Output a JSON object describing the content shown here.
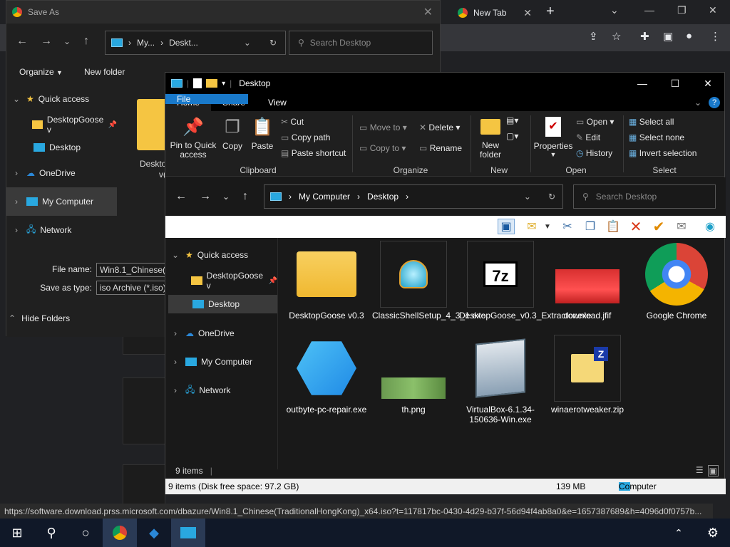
{
  "chrome": {
    "tab_title": "New Tab",
    "tab_close": "✕",
    "new_tab": "+"
  },
  "save_as": {
    "title": "Save As",
    "address": [
      "My...",
      "Deskt..."
    ],
    "search_placeholder": "Search Desktop",
    "organize": "Organize",
    "new_folder": "New folder",
    "tree": [
      {
        "label": "Quick access"
      },
      {
        "label": "DesktopGoose v"
      },
      {
        "label": "Desktop"
      },
      {
        "label": "OneDrive"
      },
      {
        "label": "My Computer"
      },
      {
        "label": "Network"
      }
    ],
    "file_name_label": "File name:",
    "file_name_value": "Win8.1_Chinese(T",
    "save_as_type_label": "Save as type:",
    "save_as_type_value": "iso Archive (*.iso)",
    "hide_folders": "Hide Folders",
    "partial_file_label": "Deskto",
    "partial_file_label2": "v("
  },
  "explorer": {
    "title": "Desktop",
    "tabs": [
      "File",
      "Home",
      "Share",
      "View"
    ],
    "ribbon": {
      "pin": "Pin to Quick access",
      "copy": "Copy",
      "paste": "Paste",
      "cut": "Cut",
      "copy_path": "Copy path",
      "paste_shortcut": "Paste shortcut",
      "clipboard": "Clipboard",
      "move_to": "Move to",
      "copy_to": "Copy to",
      "delete": "Delete",
      "rename": "Rename",
      "organize": "Organize",
      "new_folder": "New folder",
      "new": "New",
      "properties": "Properties",
      "open": "Open",
      "edit": "Edit",
      "history": "History",
      "open_group": "Open",
      "select_all": "Select all",
      "select_none": "Select none",
      "invert_selection": "Invert selection",
      "select_group": "Select"
    },
    "address": [
      "My Computer",
      "Desktop"
    ],
    "search_placeholder": "Search Desktop",
    "tree": [
      {
        "label": "Quick access"
      },
      {
        "label": "DesktopGoose v"
      },
      {
        "label": "Desktop"
      },
      {
        "label": "OneDrive"
      },
      {
        "label": "My Computer"
      },
      {
        "label": "Network"
      }
    ],
    "files": [
      {
        "name": "DesktopGoose v0.3",
        "icon": "folder-icon"
      },
      {
        "name": "ClassicShellSetup_4_3_1.exe",
        "icon": "shell-icon"
      },
      {
        "name": "DesktopGoose_v0.3_Extractor.exe",
        "icon": "7z-icon"
      },
      {
        "name": "download.jfif",
        "icon": "image-icon"
      },
      {
        "name": "Google Chrome",
        "icon": "chrome-icon"
      },
      {
        "name": "outbyte-pc-repair.exe",
        "icon": "outbyte-icon"
      },
      {
        "name": "th.png",
        "icon": "image-icon"
      },
      {
        "name": "VirtualBox-6.1.34-150636-Win.exe",
        "icon": "virtualbox-icon"
      },
      {
        "name": "winaerotweaker.zip",
        "icon": "zip-icon"
      }
    ],
    "item_count": "9 items",
    "status_left": "9 items (Disk free space: 97.2 GB)",
    "status_size": "139 MB",
    "status_location": "Computer"
  },
  "chrome_status_url": "https://software.download.prss.microsoft.com/dbazure/Win8.1_Chinese(TraditionalHongKong)_x64.iso?t=117817bc-0430-4d29-b37f-56d94f4ab8a0&e=1657387689&h=4096d0f0757b...",
  "colors": {
    "accent": "#1979ca",
    "folder": "#f5c542",
    "taskbar": "#101828"
  }
}
